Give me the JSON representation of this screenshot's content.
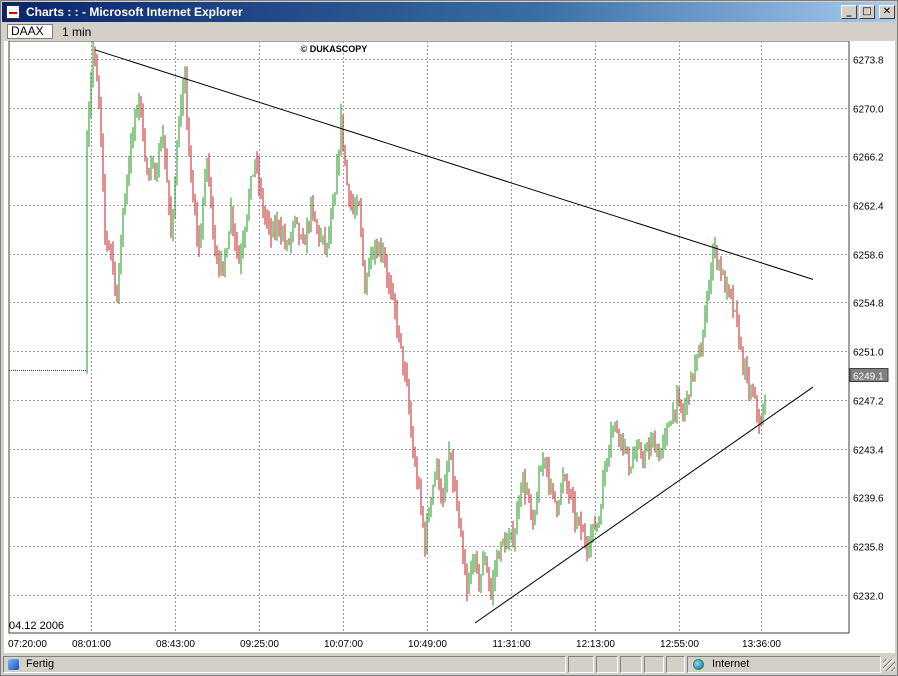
{
  "window": {
    "title": "Charts : : - Microsoft Internet Explorer",
    "buttons": {
      "minimize": "_",
      "maximize": "□",
      "close": "✕"
    }
  },
  "toolbar": {
    "symbol": "DAAX",
    "period": "1 min"
  },
  "chart": {
    "watermark": "© DUKASCOPY",
    "date_label": "04.12 2006",
    "last_price_label": "6249.1",
    "colors": {
      "up": "#1c9a1c",
      "down": "#c02020",
      "grid": "#a0a0a0",
      "trend": "#000000",
      "prefill": "#b00000",
      "last_price_bg": "#808080"
    }
  },
  "chart_data": {
    "type": "ohlc",
    "x_tick_labels": [
      "07:20:00",
      "08:01:00",
      "08:43:00",
      "09:25:00",
      "10:07:00",
      "10:49:00",
      "11:31:00",
      "12:13:00",
      "12:55:00",
      "13:36:00"
    ],
    "y_tick_labels": [
      "6273.8",
      "6270.0",
      "6266.2",
      "6262.4",
      "6258.6",
      "6254.8",
      "6251.0",
      "6247.2",
      "6243.4",
      "6239.6",
      "6235.8",
      "6232.0"
    ],
    "y_ticks": [
      6273.8,
      6270.0,
      6266.2,
      6262.4,
      6258.6,
      6254.8,
      6251.0,
      6247.2,
      6243.4,
      6239.6,
      6235.8,
      6232.0
    ],
    "x_ticks": [
      "07:20",
      "08:01",
      "08:43",
      "09:25",
      "10:07",
      "10:49",
      "11:31",
      "12:13",
      "12:55",
      "13:36"
    ],
    "last_price": 6249.1,
    "pre_open_level": 6249.5,
    "price_path": [
      [
        "07:59",
        6249.5
      ],
      [
        "08:00",
        6268.0
      ],
      [
        "08:03",
        6274.5
      ],
      [
        "08:06",
        6270.5
      ],
      [
        "08:09",
        6260.0
      ],
      [
        "08:12",
        6259.0
      ],
      [
        "08:15",
        6255.0
      ],
      [
        "08:18",
        6262.0
      ],
      [
        "08:22",
        6267.0
      ],
      [
        "08:26",
        6271.0
      ],
      [
        "08:30",
        6265.0
      ],
      [
        "08:34",
        6265.0
      ],
      [
        "08:38",
        6268.0
      ],
      [
        "08:42",
        6260.0
      ],
      [
        "08:46",
        6269.0
      ],
      [
        "08:49",
        6272.0
      ],
      [
        "08:52",
        6264.0
      ],
      [
        "08:56",
        6259.0
      ],
      [
        "09:00",
        6266.0
      ],
      [
        "09:04",
        6259.0
      ],
      [
        "09:08",
        6257.0
      ],
      [
        "09:12",
        6262.0
      ],
      [
        "09:16",
        6258.0
      ],
      [
        "09:20",
        6262.0
      ],
      [
        "09:24",
        6266.0
      ],
      [
        "09:28",
        6262.0
      ],
      [
        "09:32",
        6260.0
      ],
      [
        "09:36",
        6261.0
      ],
      [
        "09:40",
        6259.0
      ],
      [
        "09:44",
        6261.0
      ],
      [
        "09:48",
        6259.0
      ],
      [
        "09:52",
        6262.0
      ],
      [
        "09:56",
        6260.0
      ],
      [
        "10:00",
        6259.0
      ],
      [
        "10:04",
        6263.0
      ],
      [
        "10:07",
        6269.0
      ],
      [
        "10:10",
        6264.0
      ],
      [
        "10:13",
        6262.0
      ],
      [
        "10:16",
        6262.0
      ],
      [
        "10:19",
        6256.0
      ],
      [
        "10:22",
        6259.0
      ],
      [
        "10:25",
        6259.0
      ],
      [
        "10:28",
        6259.0
      ],
      [
        "10:31",
        6256.0
      ],
      [
        "10:34",
        6254.0
      ],
      [
        "10:37",
        6251.0
      ],
      [
        "10:40",
        6248.0
      ],
      [
        "10:43",
        6243.0
      ],
      [
        "10:46",
        6240.0
      ],
      [
        "10:49",
        6236.0
      ],
      [
        "10:52",
        6240.0
      ],
      [
        "10:55",
        6242.0
      ],
      [
        "10:58",
        6239.0
      ],
      [
        "11:01",
        6243.0
      ],
      [
        "11:04",
        6240.0
      ],
      [
        "11:07",
        6236.0
      ],
      [
        "11:10",
        6232.0
      ],
      [
        "11:13",
        6235.0
      ],
      [
        "11:16",
        6233.0
      ],
      [
        "11:19",
        6235.0
      ],
      [
        "11:22",
        6232.0
      ],
      [
        "11:25",
        6235.0
      ],
      [
        "11:28",
        6236.0
      ],
      [
        "11:31",
        6236.0
      ],
      [
        "11:34",
        6237.0
      ],
      [
        "11:37",
        6241.0
      ],
      [
        "11:40",
        6240.0
      ],
      [
        "11:43",
        6237.0
      ],
      [
        "11:46",
        6241.0
      ],
      [
        "11:49",
        6243.0
      ],
      [
        "11:52",
        6240.0
      ],
      [
        "11:55",
        6239.0
      ],
      [
        "11:58",
        6241.0
      ],
      [
        "12:01",
        6240.0
      ],
      [
        "12:04",
        6238.0
      ],
      [
        "12:07",
        6237.0
      ],
      [
        "12:10",
        6236.0
      ],
      [
        "12:13",
        6237.0
      ],
      [
        "12:16",
        6238.0
      ],
      [
        "12:19",
        6242.0
      ],
      [
        "12:22",
        6245.0
      ],
      [
        "12:25",
        6245.0
      ],
      [
        "12:28",
        6244.0
      ],
      [
        "12:31",
        6242.0
      ],
      [
        "12:34",
        6243.0
      ],
      [
        "12:37",
        6243.0
      ],
      [
        "12:40",
        6243.0
      ],
      [
        "12:43",
        6244.0
      ],
      [
        "12:46",
        6243.0
      ],
      [
        "12:49",
        6244.0
      ],
      [
        "12:52",
        6246.0
      ],
      [
        "12:55",
        6247.0
      ],
      [
        "12:58",
        6246.0
      ],
      [
        "13:01",
        6248.0
      ],
      [
        "13:04",
        6250.0
      ],
      [
        "13:07",
        6251.0
      ],
      [
        "13:10",
        6255.0
      ],
      [
        "13:13",
        6259.0
      ],
      [
        "13:16",
        6258.0
      ],
      [
        "13:19",
        6256.0
      ],
      [
        "13:22",
        6255.0
      ],
      [
        "13:25",
        6253.0
      ],
      [
        "13:28",
        6250.0
      ],
      [
        "13:31",
        6248.0
      ],
      [
        "13:34",
        6247.0
      ],
      [
        "13:37",
        6245.0
      ],
      [
        "13:39",
        6247.0
      ]
    ],
    "trend_lines": [
      {
        "from": [
          "08:03",
          6274.5
        ],
        "to": [
          "14:02",
          6256.6
        ]
      },
      {
        "from": [
          "11:13",
          6229.8
        ],
        "to": [
          "14:02",
          6248.2
        ]
      }
    ]
  }
}
